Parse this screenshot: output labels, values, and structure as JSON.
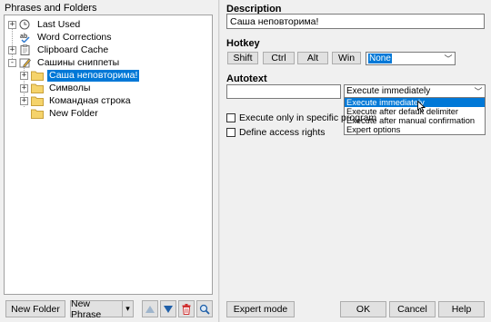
{
  "left_panel": {
    "title": "Phrases and Folders",
    "tree": [
      {
        "label": "Last Used",
        "icon": "clock-icon",
        "expander": "+"
      },
      {
        "label": "Word Corrections",
        "icon": "spellcheck-icon",
        "expander": ""
      },
      {
        "label": "Clipboard Cache",
        "icon": "clipboard-icon",
        "expander": "+"
      },
      {
        "label": "Сашины сниппеты",
        "icon": "pen-folder-icon",
        "expander": "-"
      },
      {
        "label": "Саша неповторима!",
        "icon": "folder-icon",
        "expander": "+",
        "selected": true
      },
      {
        "label": "Символы",
        "icon": "folder-icon",
        "expander": "+"
      },
      {
        "label": "Командная строка",
        "icon": "folder-icon",
        "expander": "+"
      },
      {
        "label": "New Folder",
        "icon": "folder-icon",
        "expander": ""
      }
    ],
    "buttons": {
      "new_folder": "New Folder",
      "new_phrase": "New Phrase",
      "new_phrase_arrow": "▾"
    },
    "tool_icons": [
      "move-up-icon",
      "move-down-icon",
      "delete-icon",
      "search-icon"
    ]
  },
  "right_panel": {
    "description_label": "Description",
    "description_value": "Саша неповторима!",
    "hotkey_label": "Hotkey",
    "hotkey_buttons": [
      "Shift",
      "Ctrl",
      "Alt",
      "Win"
    ],
    "hotkey_key": "None",
    "autotext_label": "Autotext",
    "autotext_value": "",
    "execute_selected": "Execute immediately",
    "execute_options": [
      "Execute immediately",
      "Execute after default delimiter",
      "Execute after manual confirmation",
      "Expert options"
    ],
    "checkbox_specific_program": "Execute only in specific program",
    "checkbox_access_rights": "Define access rights"
  },
  "bottom_buttons": {
    "expert_mode": "Expert mode",
    "ok": "OK",
    "cancel": "Cancel",
    "help": "Help"
  },
  "colors": {
    "selection": "#0078d7",
    "folder": "#f5d36b",
    "delete": "#d03030",
    "arrow": "#1f5fa8"
  }
}
